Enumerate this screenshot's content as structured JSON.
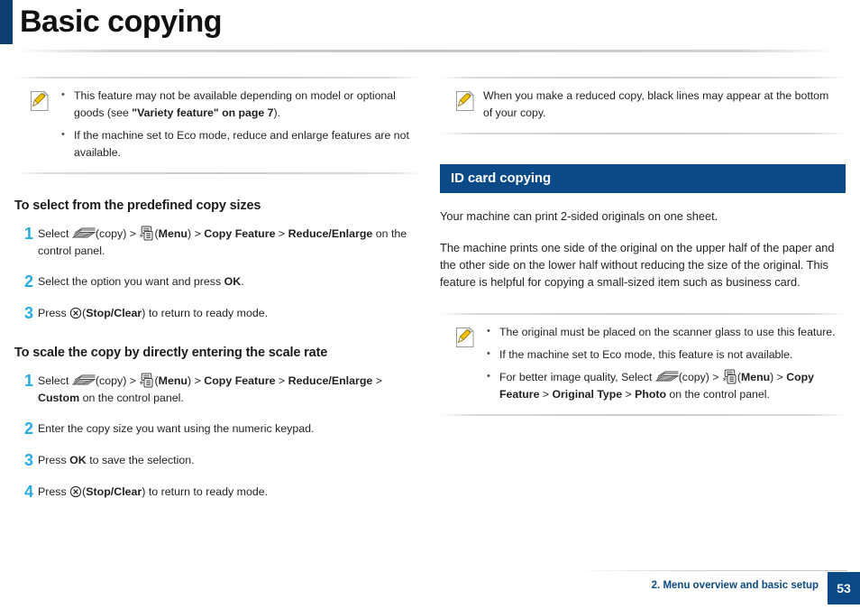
{
  "page": {
    "title": "Basic copying",
    "accent_color": "#0b3f72",
    "step_number_color": "#29abe2",
    "section_bar_color": "#0a4a86"
  },
  "left_column": {
    "note": {
      "icon": "note-pencil-icon",
      "bullets": [
        "This feature may not be available depending on model or optional goods (see \"Variety feature\" on page 7).",
        "If the machine set to Eco mode, reduce and enlarge features are not available."
      ]
    },
    "section_1": {
      "heading": "To select from the predefined copy sizes",
      "steps": [
        {
          "number": "1",
          "text": "Select  (copy) >  (Menu) > Copy Feature > Reduce/Enlarge on the control panel."
        },
        {
          "number": "2",
          "text": "Select the option you want and press OK."
        },
        {
          "number": "3",
          "text": "Press  (Stop/Clear) to return to ready mode."
        }
      ]
    },
    "section_2": {
      "heading": "To scale the copy by directly entering the scale rate",
      "steps": [
        {
          "number": "1",
          "text": "Select  (copy) >  (Menu) > Copy Feature > Reduce/Enlarge > Custom on the control panel."
        },
        {
          "number": "2",
          "text": "Enter the copy size you want using the numeric keypad."
        },
        {
          "number": "3",
          "text": "Press OK to save the selection."
        },
        {
          "number": "4",
          "text": "Press  (Stop/Clear) to return to ready mode."
        }
      ]
    }
  },
  "right_column": {
    "note_top": {
      "icon": "note-pencil-icon",
      "text": "When you make a reduced copy, black lines may appear at the bottom of your copy."
    },
    "section_bar": "ID card copying",
    "paragraphs": [
      "Your machine can print 2-sided originals on one sheet.",
      "The machine prints one side of the original on the upper half of the paper and the other side on the lower half without reducing the size of the original. This feature is helpful for copying a small-sized item such as business card."
    ],
    "note_bottom": {
      "icon": "note-pencil-icon",
      "bullets": [
        "The original must be placed on the scanner glass to use this feature.",
        "If the machine set to Eco mode, this feature is not available.",
        "For better image quality, Select  (copy) >  (Menu) > Copy Feature > Original Type > Photo on the control panel."
      ]
    }
  },
  "footer": {
    "chapter": "2. Menu overview and basic setup",
    "page_number": "53"
  },
  "inline_labels": {
    "copy": "(copy)",
    "menu": "Menu",
    "copy_feature": "Copy Feature",
    "reduce_enlarge": "Reduce/Enlarge",
    "custom": "Custom",
    "ok": "OK",
    "stop_clear": "Stop/Clear",
    "original_type": "Original Type",
    "photo": "Photo",
    "gt": ">",
    "on_control_panel": "on the control panel.",
    "select": "Select",
    "press": "Press",
    "to_ready": "to return to ready mode.",
    "variety_feature_link": "\"Variety feature\" on page 7"
  }
}
